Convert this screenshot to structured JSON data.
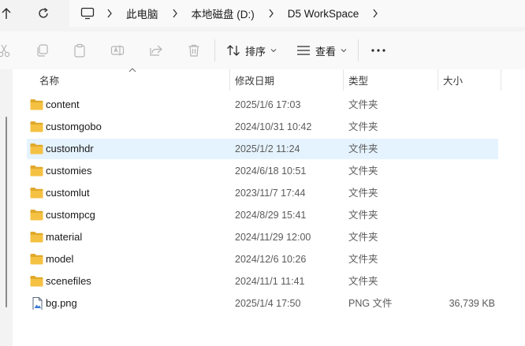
{
  "address": {
    "crumbs": [
      "此电脑",
      "本地磁盘 (D:)",
      "D5 WorkSpace"
    ]
  },
  "toolbar": {
    "sort_label": "排序",
    "view_label": "查看"
  },
  "columns": {
    "name": "名称",
    "date": "修改日期",
    "type": "类型",
    "size": "大小"
  },
  "files": [
    {
      "name": "content",
      "date": "2025/1/6 17:03",
      "type": "文件夹",
      "size": "",
      "icon": "folder-icon"
    },
    {
      "name": "customgobo",
      "date": "2024/10/31 10:42",
      "type": "文件夹",
      "size": "",
      "icon": "folder-icon"
    },
    {
      "name": "customhdr",
      "date": "2025/1/2 11:24",
      "type": "文件夹",
      "size": "",
      "icon": "folder-icon",
      "selected": true
    },
    {
      "name": "customies",
      "date": "2024/6/18 10:51",
      "type": "文件夹",
      "size": "",
      "icon": "folder-icon"
    },
    {
      "name": "customlut",
      "date": "2023/11/7 17:44",
      "type": "文件夹",
      "size": "",
      "icon": "folder-icon"
    },
    {
      "name": "custompcg",
      "date": "2024/8/29 15:41",
      "type": "文件夹",
      "size": "",
      "icon": "folder-icon"
    },
    {
      "name": "material",
      "date": "2024/11/29 12:00",
      "type": "文件夹",
      "size": "",
      "icon": "folder-icon"
    },
    {
      "name": "model",
      "date": "2024/12/6 10:26",
      "type": "文件夹",
      "size": "",
      "icon": "folder-icon"
    },
    {
      "name": "scenefiles",
      "date": "2024/11/1 11:41",
      "type": "文件夹",
      "size": "",
      "icon": "folder-icon"
    },
    {
      "name": "bg.png",
      "date": "2025/1/4 17:50",
      "type": "PNG 文件",
      "size": "36,739 KB",
      "icon": "image-file-icon"
    }
  ],
  "colors": {
    "folder": "#f5c142",
    "folder_dark": "#e0a92a",
    "selected_row": "#e5f3ff",
    "panel": "#ffffff",
    "chrome": "#f3f3f3"
  }
}
